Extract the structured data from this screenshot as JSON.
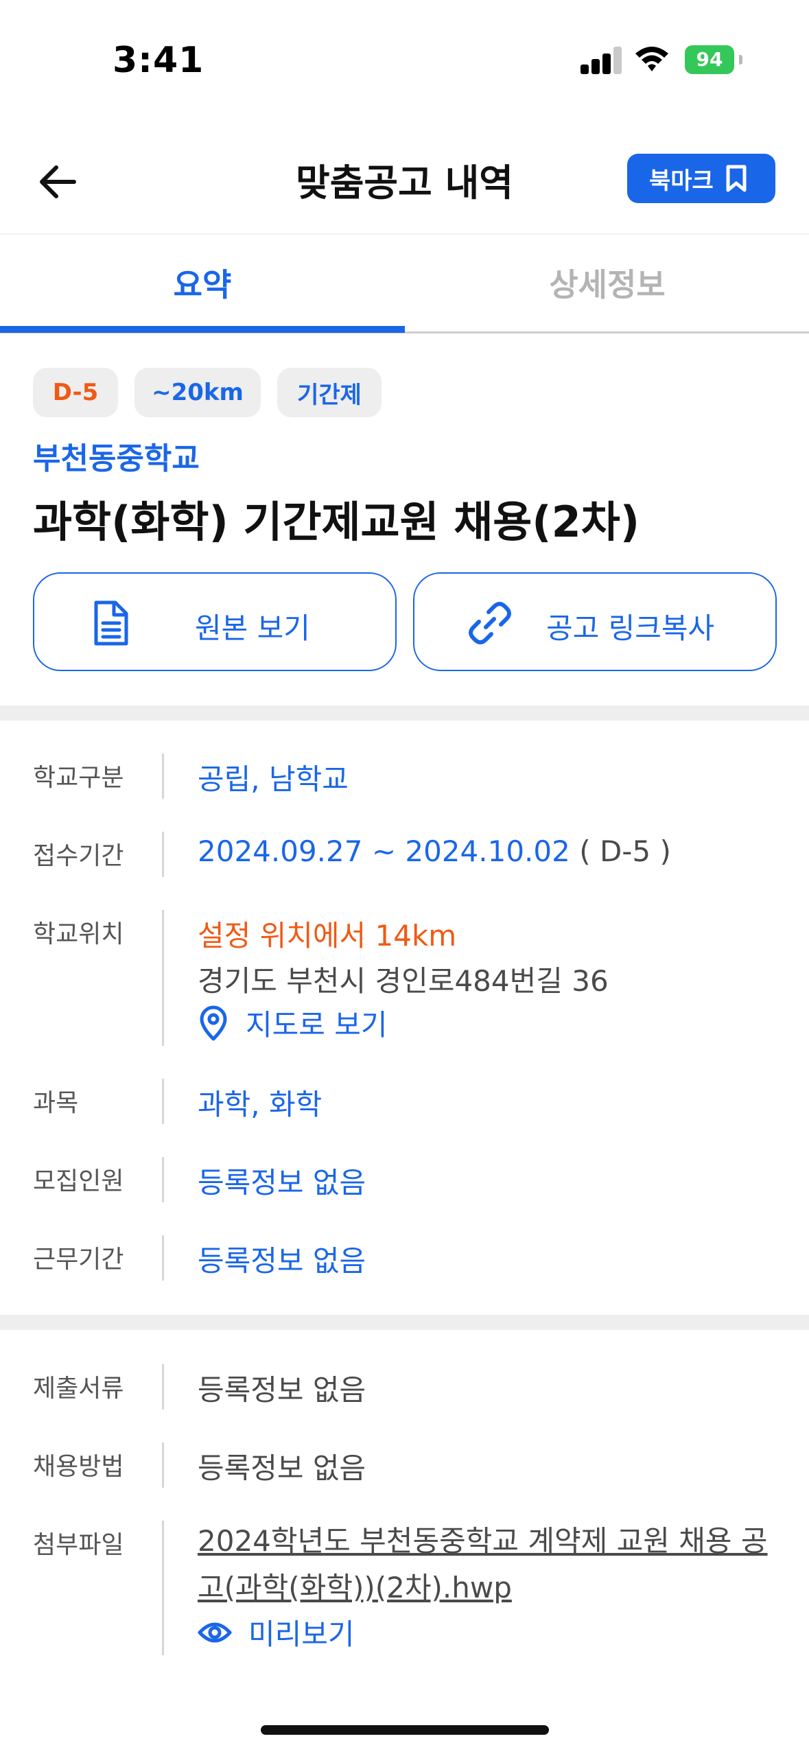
{
  "status": {
    "time": "3:41",
    "battery": "94"
  },
  "header": {
    "title": "맞춤공고 내역",
    "bookmark_label": "북마크"
  },
  "tabs": [
    {
      "label": "요약",
      "active": true
    },
    {
      "label": "상세정보",
      "active": false
    }
  ],
  "chips": {
    "dday": "D-5",
    "distance": "~20km",
    "type": "기간제"
  },
  "school_name": "부천동중학교",
  "post_title": "과학(화학) 기간제교원 채용(2차)",
  "actions": {
    "original": "원본 보기",
    "copy_link": "공고 링크복사"
  },
  "info": {
    "school_type": {
      "label": "학교구분",
      "value": "공립, 남학교"
    },
    "period": {
      "label": "접수기간",
      "value": "2024.09.27 ~ 2024.10.02",
      "dday": "( D-5 )"
    },
    "location": {
      "label": "학교위치",
      "distance": "설정 위치에서 14km",
      "address": "경기도 부천시 경인로484번길 36",
      "map_link": "지도로 보기"
    },
    "subject": {
      "label": "과목",
      "value": "과학, 화학"
    },
    "recruits": {
      "label": "모집인원",
      "value": "등록정보 없음"
    },
    "work_period": {
      "label": "근무기간",
      "value": "등록정보 없음"
    }
  },
  "extra": {
    "documents": {
      "label": "제출서류",
      "value": "등록정보 없음"
    },
    "method": {
      "label": "채용방법",
      "value": "등록정보 없음"
    },
    "attachment": {
      "label": "첨부파일",
      "file_line1": "2024학년도 부천동중학교 계약제 교원 채용 공",
      "file_line2": "고(과학(화학))(2차).hwp",
      "preview": "미리보기"
    }
  },
  "colors": {
    "accent": "#1a66e8",
    "warning": "#f05a14",
    "battery": "#34c759"
  }
}
